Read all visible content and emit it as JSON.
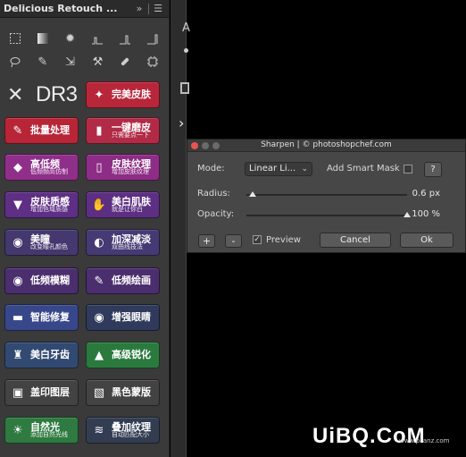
{
  "panel": {
    "title": "Delicious Retouch ...",
    "collapse_glyph": "»",
    "menu_glyph": "☰",
    "logo_text": "DR3",
    "buttons": [
      {
        "main": "完美皮肤",
        "sub": "",
        "color": "#b8263a",
        "icon": "sparkle-icon"
      },
      {
        "main": "批量处理",
        "sub": "",
        "color": "#b72537",
        "icon": "brush-icon"
      },
      {
        "main": "一键磨皮",
        "sub": "只需要点一下",
        "color": "#b12b46",
        "icon": "bottle-icon"
      },
      {
        "main": "高低频",
        "sub": "低频频高仿制",
        "color": "#8f2f8a",
        "icon": "diamond-icon"
      },
      {
        "main": "皮肤纹理",
        "sub": "增加皮肤纹理",
        "color": "#8d2d86",
        "icon": "spray-icon"
      },
      {
        "main": "皮肤质感",
        "sub": "增加色域质感",
        "color": "#5e2f84",
        "icon": "cup-icon"
      },
      {
        "main": "美白肌肤",
        "sub": "就是让你白",
        "color": "#5d2f83",
        "icon": "hand-icon"
      },
      {
        "main": "美瞳",
        "sub": "改变瞳孔颜色",
        "color": "#44386f",
        "icon": "eye-circle-icon"
      },
      {
        "main": "加深减淡",
        "sub": "双曲线技法",
        "color": "#463a74",
        "icon": "half-circle-icon"
      },
      {
        "main": "低频模糊",
        "sub": "",
        "color": "#4b2e6e",
        "icon": "eye-icon"
      },
      {
        "main": "低频绘画",
        "sub": "",
        "color": "#4b2e6e",
        "icon": "paint-brush-icon"
      },
      {
        "main": "智能修复",
        "sub": "",
        "color": "#38478a",
        "icon": "bandage-icon"
      },
      {
        "main": "增强眼睛",
        "sub": "",
        "color": "#2f3a5c",
        "icon": "eye-icon"
      },
      {
        "main": "美白牙齿",
        "sub": "",
        "color": "#324a72",
        "icon": "tooth-icon"
      },
      {
        "main": "高级锐化",
        "sub": "",
        "color": "#2a7a3e",
        "icon": "triangle-icon"
      },
      {
        "main": "盖印图层",
        "sub": "",
        "color": "#434343",
        "icon": "layers-icon"
      },
      {
        "main": "黑色蒙版",
        "sub": "",
        "color": "#434343",
        "icon": "mask-icon"
      },
      {
        "main": "自然光",
        "sub": "添加自然光线",
        "color": "#2e7a40",
        "icon": "sun-icon"
      },
      {
        "main": "叠加纹理",
        "sub": "自动匹配大小",
        "color": "#333d52",
        "icon": "stack-icon"
      }
    ]
  },
  "strip": {
    "letter": "A",
    "chevron": "›"
  },
  "dialog": {
    "title": "Sharpen | © photoshopchef.com",
    "mode_label": "Mode:",
    "mode_value": "Linear Li...",
    "smart_mask_label": "Add Smart Mask",
    "help_label": "?",
    "radius_label": "Radius:",
    "radius_value": "0.6 px",
    "radius_level": 0.04,
    "opacity_label": "Opacity:",
    "opacity_value": "100 %",
    "opacity_level": 1.0,
    "plus_label": "+",
    "minus_label": "-",
    "preview_label": "Preview",
    "preview_checked": "✓",
    "cancel_label": "Cancel",
    "ok_label": "Ok"
  },
  "watermark": {
    "text": "UiBQ.CoM",
    "sub": "www.psanz.com"
  }
}
